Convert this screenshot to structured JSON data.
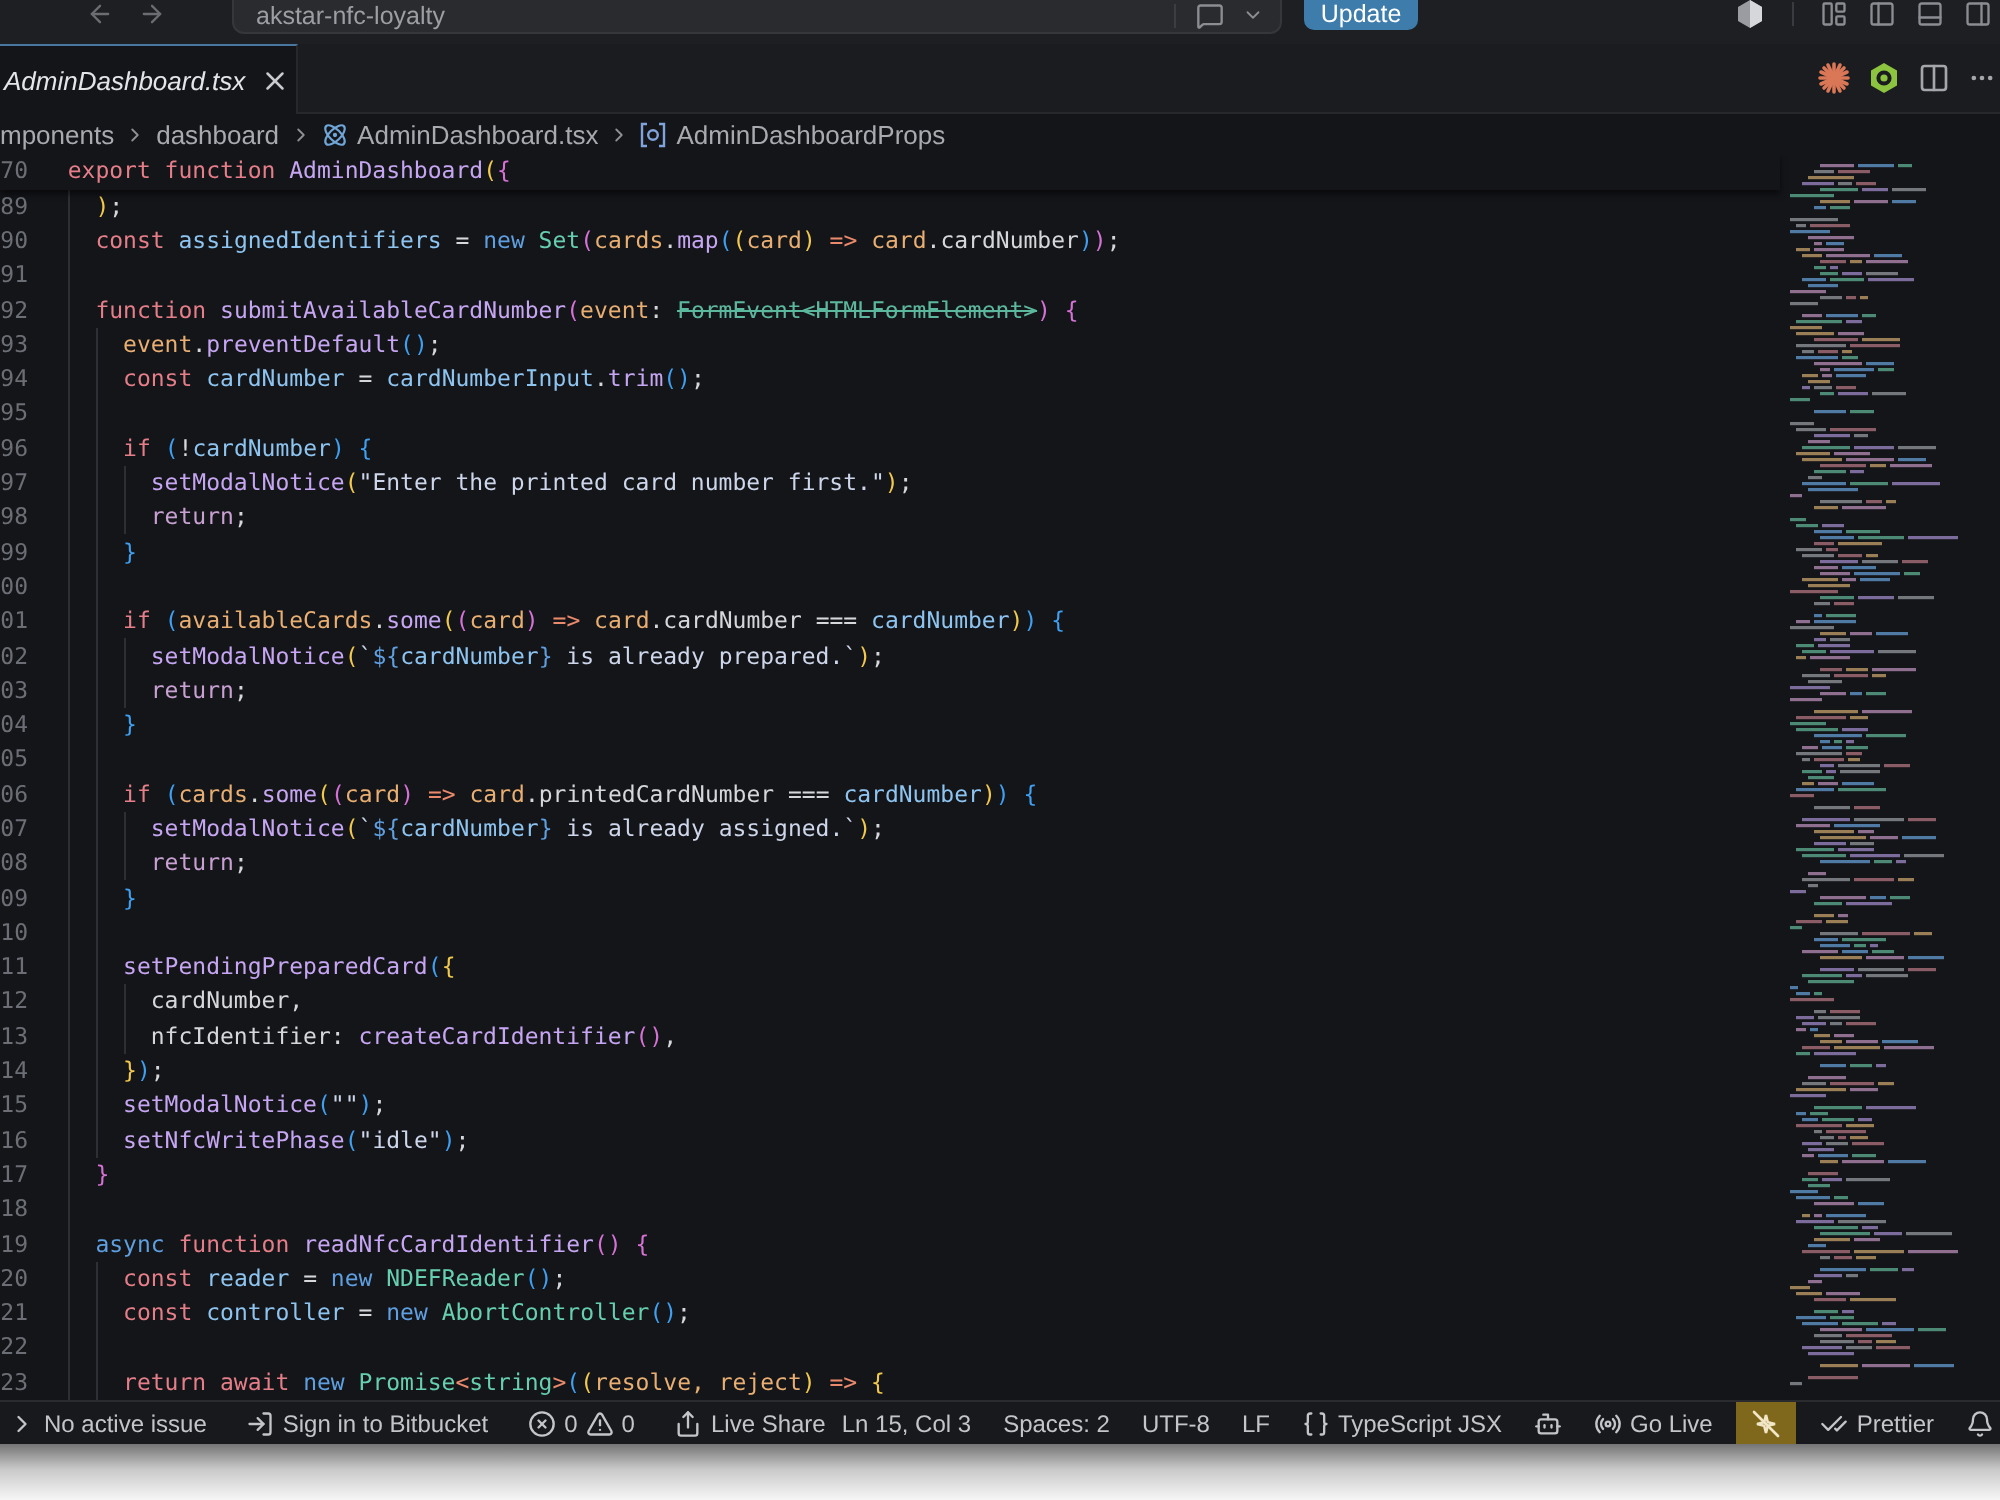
{
  "title_bar": {
    "workspace": "akstar-nfc-loyalty",
    "update_button": "Update"
  },
  "tabs": [
    {
      "label": "AdminDashboard.tsx",
      "selected": true,
      "preview": true
    }
  ],
  "breadcrumbs": [
    {
      "label": "mponents",
      "kind": "folder"
    },
    {
      "label": "dashboard",
      "kind": "folder"
    },
    {
      "label": "AdminDashboard.tsx",
      "kind": "react-file"
    },
    {
      "label": "AdminDashboardProps",
      "kind": "symbol"
    }
  ],
  "editor": {
    "sticky_line": {
      "number": "70",
      "tokens": [
        {
          "text": "  export function ",
          "kind": "keyword"
        },
        {
          "text": "AdminDashboard",
          "kind": "function"
        },
        {
          "text": "(",
          "kind": "bracket-gold"
        },
        {
          "text": "{",
          "kind": "bracket-pink"
        }
      ]
    },
    "lines": [
      {
        "number": "89",
        "tokens": [
          {
            "text": "    )",
            "kind": "bracket-gold"
          },
          {
            "text": ";",
            "kind": "plain"
          }
        ]
      },
      {
        "number": "90",
        "tokens": [
          {
            "text": "    const ",
            "kind": "keyword"
          },
          {
            "text": "assignedIdentifiers",
            "kind": "variable"
          },
          {
            "text": " = ",
            "kind": "plain"
          },
          {
            "text": "new ",
            "kind": "storage"
          },
          {
            "text": "Set",
            "kind": "type"
          },
          {
            "text": "(",
            "kind": "bracket-pink"
          },
          {
            "text": "cards",
            "kind": "param"
          },
          {
            "text": ".",
            "kind": "plain"
          },
          {
            "text": "map",
            "kind": "function"
          },
          {
            "text": "(",
            "kind": "bracket-blue"
          },
          {
            "text": "(",
            "kind": "bracket-gold"
          },
          {
            "text": "card",
            "kind": "param"
          },
          {
            "text": ")",
            "kind": "bracket-gold"
          },
          {
            "text": " => ",
            "kind": "arrow"
          },
          {
            "text": "card",
            "kind": "param"
          },
          {
            "text": ".cardNumber",
            "kind": "plain"
          },
          {
            "text": ")",
            "kind": "bracket-blue"
          },
          {
            "text": ")",
            "kind": "bracket-pink"
          },
          {
            "text": ";",
            "kind": "plain"
          }
        ]
      },
      {
        "number": "91"
      },
      {
        "number": "92",
        "tokens": [
          {
            "text": "    function ",
            "kind": "keyword"
          },
          {
            "text": "submitAvailableCardNumber",
            "kind": "function"
          },
          {
            "text": "(",
            "kind": "bracket-pink"
          },
          {
            "text": "event",
            "kind": "param"
          },
          {
            "text": ": ",
            "kind": "plain"
          },
          {
            "text": "FormEvent<HTMLFormElement>",
            "kind": "deprecated"
          },
          {
            "text": ") {",
            "kind": "bracket-pink"
          }
        ]
      },
      {
        "number": "93",
        "tokens": [
          {
            "text": "      event",
            "kind": "param"
          },
          {
            "text": ".",
            "kind": "plain"
          },
          {
            "text": "preventDefault",
            "kind": "function"
          },
          {
            "text": "()",
            "kind": "bracket-blue"
          },
          {
            "text": ";",
            "kind": "plain"
          }
        ]
      },
      {
        "number": "94",
        "tokens": [
          {
            "text": "      const ",
            "kind": "keyword"
          },
          {
            "text": "cardNumber",
            "kind": "variable"
          },
          {
            "text": " = ",
            "kind": "plain"
          },
          {
            "text": "cardNumberInput",
            "kind": "variable"
          },
          {
            "text": ".",
            "kind": "plain"
          },
          {
            "text": "trim",
            "kind": "function"
          },
          {
            "text": "()",
            "kind": "bracket-blue"
          },
          {
            "text": ";",
            "kind": "plain"
          }
        ]
      },
      {
        "number": "95"
      },
      {
        "number": "96",
        "tokens": [
          {
            "text": "      if ",
            "kind": "keyword"
          },
          {
            "text": "(",
            "kind": "bracket-blue"
          },
          {
            "text": "!",
            "kind": "plain"
          },
          {
            "text": "cardNumber",
            "kind": "variable"
          },
          {
            "text": ") {",
            "kind": "bracket-blue"
          }
        ]
      },
      {
        "number": "97",
        "tokens": [
          {
            "text": "        setModalNotice",
            "kind": "function"
          },
          {
            "text": "(",
            "kind": "bracket-gold"
          },
          {
            "text": "\"Enter the printed card number first.\"",
            "kind": "string"
          },
          {
            "text": ")",
            "kind": "bracket-gold"
          },
          {
            "text": ";",
            "kind": "plain"
          }
        ]
      },
      {
        "number": "98",
        "tokens": [
          {
            "text": "        return",
            "kind": "control"
          },
          {
            "text": ";",
            "kind": "plain"
          }
        ]
      },
      {
        "number": "99",
        "tokens": [
          {
            "text": "      }",
            "kind": "bracket-blue"
          }
        ]
      },
      {
        "number": "00"
      },
      {
        "number": "01",
        "tokens": [
          {
            "text": "      if ",
            "kind": "keyword"
          },
          {
            "text": "(",
            "kind": "bracket-blue"
          },
          {
            "text": "availableCards",
            "kind": "param"
          },
          {
            "text": ".",
            "kind": "plain"
          },
          {
            "text": "some",
            "kind": "function"
          },
          {
            "text": "(",
            "kind": "bracket-gold"
          },
          {
            "text": "(",
            "kind": "bracket-pink"
          },
          {
            "text": "card",
            "kind": "param"
          },
          {
            "text": ")",
            "kind": "bracket-pink"
          },
          {
            "text": " => ",
            "kind": "arrow"
          },
          {
            "text": "card",
            "kind": "param"
          },
          {
            "text": ".cardNumber === ",
            "kind": "plain"
          },
          {
            "text": "cardNumber",
            "kind": "variable"
          },
          {
            "text": ")",
            "kind": "bracket-gold"
          },
          {
            "text": ") {",
            "kind": "bracket-blue"
          }
        ]
      },
      {
        "number": "02",
        "tokens": [
          {
            "text": "        setModalNotice",
            "kind": "function"
          },
          {
            "text": "(",
            "kind": "bracket-gold"
          },
          {
            "text": "`",
            "kind": "string"
          },
          {
            "text": "${",
            "kind": "template"
          },
          {
            "text": "cardNumber",
            "kind": "variable"
          },
          {
            "text": "}",
            "kind": "template"
          },
          {
            "text": " is already prepared.`",
            "kind": "string"
          },
          {
            "text": ")",
            "kind": "bracket-gold"
          },
          {
            "text": ";",
            "kind": "plain"
          }
        ]
      },
      {
        "number": "03",
        "tokens": [
          {
            "text": "        return",
            "kind": "control"
          },
          {
            "text": ";",
            "kind": "plain"
          }
        ]
      },
      {
        "number": "04",
        "tokens": [
          {
            "text": "      }",
            "kind": "bracket-blue"
          }
        ]
      },
      {
        "number": "05"
      },
      {
        "number": "06",
        "tokens": [
          {
            "text": "      if ",
            "kind": "keyword"
          },
          {
            "text": "(",
            "kind": "bracket-blue"
          },
          {
            "text": "cards",
            "kind": "param"
          },
          {
            "text": ".",
            "kind": "plain"
          },
          {
            "text": "some",
            "kind": "function"
          },
          {
            "text": "(",
            "kind": "bracket-gold"
          },
          {
            "text": "(",
            "kind": "bracket-pink"
          },
          {
            "text": "card",
            "kind": "param"
          },
          {
            "text": ")",
            "kind": "bracket-pink"
          },
          {
            "text": " => ",
            "kind": "arrow"
          },
          {
            "text": "card",
            "kind": "param"
          },
          {
            "text": ".printedCardNumber === ",
            "kind": "plain"
          },
          {
            "text": "cardNumber",
            "kind": "variable"
          },
          {
            "text": ")",
            "kind": "bracket-gold"
          },
          {
            "text": ") {",
            "kind": "bracket-blue"
          }
        ]
      },
      {
        "number": "07",
        "tokens": [
          {
            "text": "        setModalNotice",
            "kind": "function"
          },
          {
            "text": "(",
            "kind": "bracket-gold"
          },
          {
            "text": "`",
            "kind": "string"
          },
          {
            "text": "${",
            "kind": "template"
          },
          {
            "text": "cardNumber",
            "kind": "variable"
          },
          {
            "text": "}",
            "kind": "template"
          },
          {
            "text": " is already assigned.`",
            "kind": "string"
          },
          {
            "text": ")",
            "kind": "bracket-gold"
          },
          {
            "text": ";",
            "kind": "plain"
          }
        ]
      },
      {
        "number": "08",
        "tokens": [
          {
            "text": "        return",
            "kind": "control"
          },
          {
            "text": ";",
            "kind": "plain"
          }
        ]
      },
      {
        "number": "09",
        "tokens": [
          {
            "text": "      }",
            "kind": "bracket-blue"
          }
        ]
      },
      {
        "number": "10"
      },
      {
        "number": "11",
        "tokens": [
          {
            "text": "      setPendingPreparedCard",
            "kind": "function"
          },
          {
            "text": "(",
            "kind": "bracket-blue"
          },
          {
            "text": "{",
            "kind": "bracket-gold"
          }
        ]
      },
      {
        "number": "12",
        "tokens": [
          {
            "text": "        cardNumber,",
            "kind": "plain"
          }
        ]
      },
      {
        "number": "13",
        "tokens": [
          {
            "text": "        nfcIdentifier: ",
            "kind": "plain"
          },
          {
            "text": "createCardIdentifier",
            "kind": "function"
          },
          {
            "text": "()",
            "kind": "bracket-pink"
          },
          {
            "text": ",",
            "kind": "plain"
          }
        ]
      },
      {
        "number": "14",
        "tokens": [
          {
            "text": "      }",
            "kind": "bracket-gold"
          },
          {
            "text": ")",
            "kind": "bracket-blue"
          },
          {
            "text": ";",
            "kind": "plain"
          }
        ]
      },
      {
        "number": "15",
        "tokens": [
          {
            "text": "      setModalNotice",
            "kind": "function"
          },
          {
            "text": "(",
            "kind": "bracket-blue"
          },
          {
            "text": "\"\"",
            "kind": "string"
          },
          {
            "text": ")",
            "kind": "bracket-blue"
          },
          {
            "text": ";",
            "kind": "plain"
          }
        ]
      },
      {
        "number": "16",
        "tokens": [
          {
            "text": "      setNfcWritePhase",
            "kind": "function"
          },
          {
            "text": "(",
            "kind": "bracket-blue"
          },
          {
            "text": "\"idle\"",
            "kind": "string"
          },
          {
            "text": ")",
            "kind": "bracket-blue"
          },
          {
            "text": ";",
            "kind": "plain"
          }
        ]
      },
      {
        "number": "17",
        "tokens": [
          {
            "text": "    }",
            "kind": "bracket-pink"
          }
        ]
      },
      {
        "number": "18"
      },
      {
        "number": "19",
        "tokens": [
          {
            "text": "    async ",
            "kind": "storage"
          },
          {
            "text": "function ",
            "kind": "keyword"
          },
          {
            "text": "readNfcCardIdentifier",
            "kind": "function"
          },
          {
            "text": "() {",
            "kind": "bracket-pink"
          }
        ]
      },
      {
        "number": "20",
        "tokens": [
          {
            "text": "      const ",
            "kind": "keyword"
          },
          {
            "text": "reader",
            "kind": "variable"
          },
          {
            "text": " = ",
            "kind": "plain"
          },
          {
            "text": "new ",
            "kind": "storage"
          },
          {
            "text": "NDEFReader",
            "kind": "type"
          },
          {
            "text": "()",
            "kind": "bracket-blue"
          },
          {
            "text": ";",
            "kind": "plain"
          }
        ]
      },
      {
        "number": "21",
        "tokens": [
          {
            "text": "      const ",
            "kind": "keyword"
          },
          {
            "text": "controller",
            "kind": "variable"
          },
          {
            "text": " = ",
            "kind": "plain"
          },
          {
            "text": "new ",
            "kind": "storage"
          },
          {
            "text": "AbortController",
            "kind": "type"
          },
          {
            "text": "()",
            "kind": "bracket-blue"
          },
          {
            "text": ";",
            "kind": "plain"
          }
        ]
      },
      {
        "number": "22"
      },
      {
        "number": "23",
        "tokens": [
          {
            "text": "      return await ",
            "kind": "keyword"
          },
          {
            "text": "new ",
            "kind": "storage"
          },
          {
            "text": "Promise",
            "kind": "type"
          },
          {
            "text": "<",
            "kind": "arrow"
          },
          {
            "text": "string",
            "kind": "type"
          },
          {
            "text": ">",
            "kind": "arrow"
          },
          {
            "text": "(",
            "kind": "bracket-blue"
          },
          {
            "text": "(",
            "kind": "bracket-gold"
          },
          {
            "text": "resolve, reject",
            "kind": "param"
          },
          {
            "text": ")",
            "kind": "bracket-gold"
          },
          {
            "text": " => ",
            "kind": "arrow"
          },
          {
            "text": "{",
            "kind": "bracket-gold"
          }
        ]
      }
    ]
  },
  "status_bar": {
    "left": [
      {
        "kind": "issues",
        "label": "No active issue",
        "highlighted": false
      },
      {
        "kind": "account",
        "label": "Sign in to Bitbucket",
        "highlighted": false
      },
      {
        "kind": "problems",
        "errors": "0",
        "warnings": "0",
        "highlighted": false
      },
      {
        "kind": "live-share",
        "label": "Live Share",
        "highlighted": false
      }
    ],
    "right": [
      {
        "kind": "text",
        "label": "Ln 15, Col 3",
        "highlighted": false
      },
      {
        "kind": "text",
        "label": "Spaces: 2",
        "highlighted": false
      },
      {
        "kind": "text",
        "label": "UTF-8",
        "highlighted": false
      },
      {
        "kind": "text",
        "label": "LF",
        "highlighted": false
      },
      {
        "kind": "language",
        "label": "TypeScript JSX",
        "highlighted": false
      },
      {
        "kind": "copilot",
        "highlighted": false
      },
      {
        "kind": "go-live",
        "label": "Go Live",
        "highlighted": false
      },
      {
        "kind": "toggle",
        "highlighted": true
      },
      {
        "kind": "prettier",
        "label": "Prettier",
        "highlighted": false
      },
      {
        "kind": "notifications",
        "highlighted": false
      }
    ]
  }
}
